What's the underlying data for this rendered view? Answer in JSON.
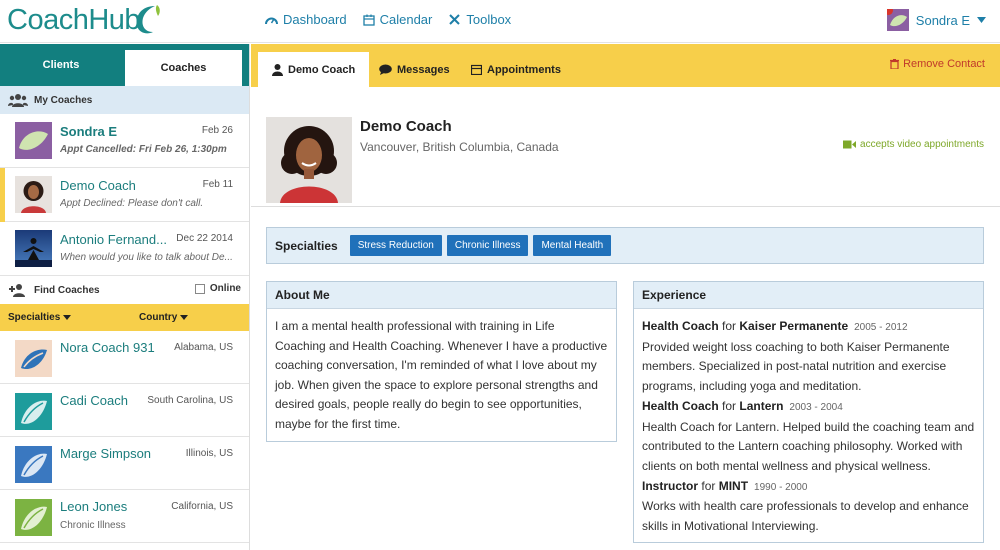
{
  "app": {
    "logo_text": "CoachHub"
  },
  "topnav": {
    "items": [
      {
        "label": "Dashboard",
        "icon": "dashboard-icon"
      },
      {
        "label": "Calendar",
        "icon": "calendar-icon"
      },
      {
        "label": "Toolbox",
        "icon": "toolbox-icon"
      }
    ],
    "user_name": "Sondra E"
  },
  "sidebar": {
    "tabs": [
      "Clients",
      "Coaches"
    ],
    "active_tab": "Coaches",
    "my_coaches_label": "My Coaches",
    "my_coaches": [
      {
        "name": "Sondra E",
        "date": "Feb 26",
        "note": "Appt Cancelled: Fri Feb 26, 1:30pm",
        "bold": true
      },
      {
        "name": "Demo Coach",
        "date": "Feb 11",
        "note": "Appt Declined: Please don't call.",
        "bold": false
      },
      {
        "name": "Antonio Fernand...",
        "date": "Dec 22 2014",
        "note": "When would you like to talk about De...",
        "bold": false
      }
    ],
    "find_coaches_label": "Find Coaches",
    "online_label": "Online",
    "filter_specialties": "Specialties",
    "filter_country": "Country",
    "found_coaches": [
      {
        "name": "Nora Coach 931",
        "location": "Alabama, US",
        "sub": ""
      },
      {
        "name": "Cadi Coach",
        "location": "South Carolina, US",
        "sub": ""
      },
      {
        "name": "Marge Simpson",
        "location": "Illinois, US",
        "sub": ""
      },
      {
        "name": "Leon Jones",
        "location": "California, US",
        "sub": "Chronic Illness"
      }
    ]
  },
  "main": {
    "tabs": [
      "Demo Coach",
      "Messages",
      "Appointments"
    ],
    "remove_label": "Remove Contact",
    "profile": {
      "name": "Demo Coach",
      "location": "Vancouver, British Columbia, Canada",
      "video_label": "accepts video appointments"
    },
    "specialties_label": "Specialties",
    "specialties": [
      "Stress Reduction",
      "Chronic Illness",
      "Mental Health"
    ],
    "about_title": "About Me",
    "about_text": "I am a mental health professional with training in Life Coaching and Health Coaching. Whenever I have a productive coaching conversation, I'm reminded of what I love about my job. When given the space to explore personal strengths and desired goals, people really do begin to see opportunities, maybe for the first time.",
    "experience_title": "Experience",
    "experience": [
      {
        "role": "Health Coach",
        "for": "for",
        "org": "Kaiser Permanente",
        "years": "2005 - 2012",
        "desc": "Provided weight loss coaching to both Kaiser Permanente members. Specialized in post-natal nutrition and exercise programs, including yoga and meditation."
      },
      {
        "role": "Health Coach",
        "for": "for",
        "org": "Lantern",
        "years": "2003 - 2004",
        "desc": "Health Coach for Lantern. Helped build the coaching team and contributed to the Lantern coaching philosophy. Worked with clients on both mental wellness and physical wellness."
      },
      {
        "role": "Instructor",
        "for": "for",
        "org": "MINT",
        "years": "1990 - 2000",
        "desc": "Works with health care professionals to develop and enhance skills in Motivational Interviewing."
      }
    ]
  },
  "colors": {
    "teal": "#127f7f",
    "yellow": "#f7cf4a",
    "link": "#1e7fa8",
    "tag": "#2071ba",
    "panel_header": "#e2eef7",
    "remove": "#c0392b",
    "video": "#7ea829"
  }
}
